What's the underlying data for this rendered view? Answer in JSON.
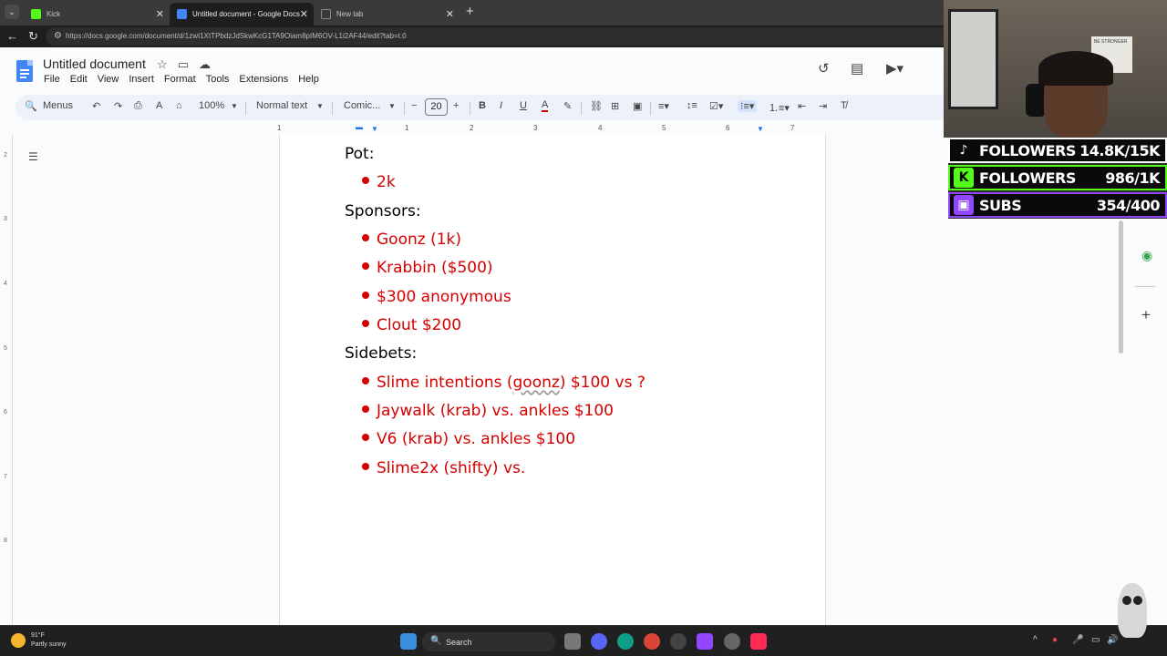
{
  "browser": {
    "tabs": [
      {
        "label": "Kick",
        "color": "#53fc18"
      },
      {
        "label": "Untitled document - Google Docs",
        "color": "#4285f4"
      },
      {
        "label": "New tab",
        "color": "#888888"
      }
    ],
    "url": "https://docs.google.com/document/d/1zwI1XtTPbdzJdSkwKcG1TA9Oiam8pIM6OV-L1i2AF44/edit?tab=t.0"
  },
  "docs": {
    "title": "Untitled document",
    "menu": [
      "File",
      "Edit",
      "View",
      "Insert",
      "Format",
      "Tools",
      "Extensions",
      "Help"
    ],
    "toolbar": {
      "menus": "Menus",
      "zoom": "100%",
      "style": "Normal text",
      "font": "Comic...",
      "font_size": "20"
    },
    "ruler": [
      "1",
      "1",
      "2",
      "3",
      "4",
      "5",
      "6",
      "7"
    ],
    "vruler": [
      "2",
      "3",
      "4",
      "5",
      "6",
      "7",
      "8"
    ]
  },
  "document": {
    "h_pot": "Pot:",
    "pot_items": [
      "2k"
    ],
    "h_sponsors": "Sponsors:",
    "sponsor_items": [
      "Goonz (1k)",
      "Krabbin ($500)",
      "$300 anonymous",
      "Clout $200"
    ],
    "h_sidebets": "Sidebets:",
    "sidebet_1_pre": "Slime intentions (",
    "sidebet_1_underlined": "goonz",
    "sidebet_1_post": ") $100 vs ?",
    "sidebet_items": [
      "Jaywalk (krab) vs. ankles $100",
      "V6 (krab) vs. ankles $100",
      "Slime2x (shifty) vs."
    ]
  },
  "stream_overlay": {
    "tiktok": {
      "label": "FOLLOWERS",
      "value": "14.8K/15K",
      "color": "#ffffff"
    },
    "kick": {
      "label": "FOLLOWERS",
      "value": "986/1K",
      "color": "#53fc18"
    },
    "twitch": {
      "label": "SUBS",
      "value": "354/400",
      "color": "#9146ff"
    },
    "poster_text": "BE STRONGER"
  },
  "taskbar": {
    "temp": "91°F",
    "weather": "Partly sunny",
    "search": "Search"
  }
}
